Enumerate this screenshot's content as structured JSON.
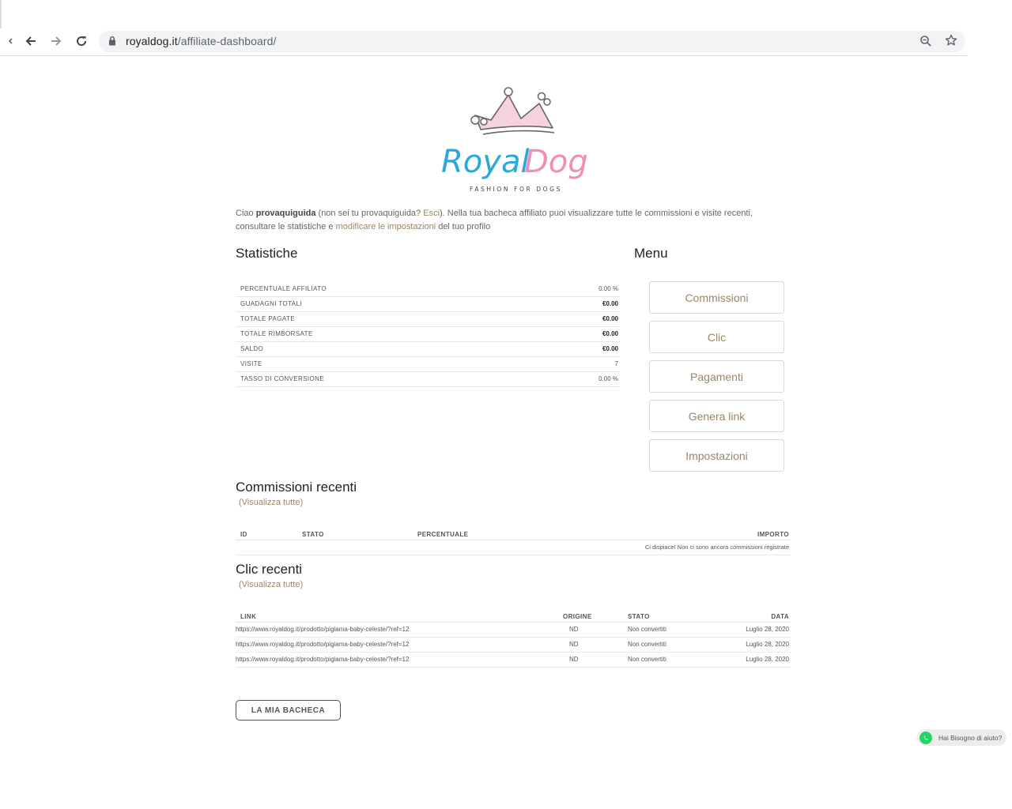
{
  "browser": {
    "url_domain": "royaldog.it",
    "url_path": "/affiliate-dashboard/"
  },
  "logo": {
    "brand_royal": "Royal",
    "brand_dog": "Dog",
    "tagline": "FASHION FOR DOGS",
    "colors": {
      "royal": "#29a9d9",
      "dog": "#ee8fb6",
      "crown": "#f6d2de"
    }
  },
  "intro": {
    "ciao": "Ciao ",
    "user": "provaquiguida",
    "notyou_pre": " (non sei tu provaquiguida? ",
    "logout": "Esci",
    "body": "). Nella tua bacheca affiliato puoi visualizzare tutte le commissioni e visite recenti, consultare le statistiche e ",
    "settings_link": "modificare le impostazioni",
    "tail": " del tuo profilo"
  },
  "stats": {
    "title": "Statistiche",
    "rows": [
      {
        "label": "PERCENTUALE AFFILIATO",
        "value": "0.00 %"
      },
      {
        "label": "GUADAGNI TOTALI",
        "value": "€0.00"
      },
      {
        "label": "TOTALE PAGATE",
        "value": "€0.00"
      },
      {
        "label": "TOTALE RIMBORSATE",
        "value": "€0.00"
      },
      {
        "label": "SALDO",
        "value": "€0.00"
      },
      {
        "label": "VISITE",
        "value": "7"
      },
      {
        "label": "TASSO DI CONVERSIONE",
        "value": "0.00 %"
      }
    ]
  },
  "menu": {
    "title": "Menu",
    "items": [
      "Commissioni",
      "Clic",
      "Pagamenti",
      "Genera link",
      "Impostazioni"
    ]
  },
  "commissions": {
    "title": "Commissioni recenti",
    "view_all": "(Visualizza tutte)",
    "headers": [
      "ID",
      "STATO",
      "PERCENTUALE",
      "IMPORTO"
    ],
    "empty": "Ci dispiace! Non ci sono ancora commissioni registrate"
  },
  "clicks": {
    "title": "Clic recenti",
    "view_all": "(Visualizza tutte)",
    "headers": [
      "LINK",
      "ORIGINE",
      "STATO",
      "DATA"
    ],
    "rows": [
      {
        "link": "https://www.royaldog.it/prodotto/pigiama-baby-celeste/?ref=12",
        "origin": "ND",
        "status": "Non convertiti",
        "date": "Luglio 28, 2020"
      },
      {
        "link": "https://www.royaldog.it/prodotto/pigiama-baby-celeste/?ref=12",
        "origin": "ND",
        "status": "Non convertiti",
        "date": "Luglio 28, 2020"
      },
      {
        "link": "https://www.royaldog.it/prodotto/pigiama-baby-celeste/?ref=12",
        "origin": "ND",
        "status": "Non convertiti",
        "date": "Luglio 28, 2020"
      }
    ]
  },
  "dashboard_button": "LA MIA BACHECA",
  "whatsapp": {
    "label": "Hai Bisogno di aiuto?",
    "color": "#25d366"
  }
}
